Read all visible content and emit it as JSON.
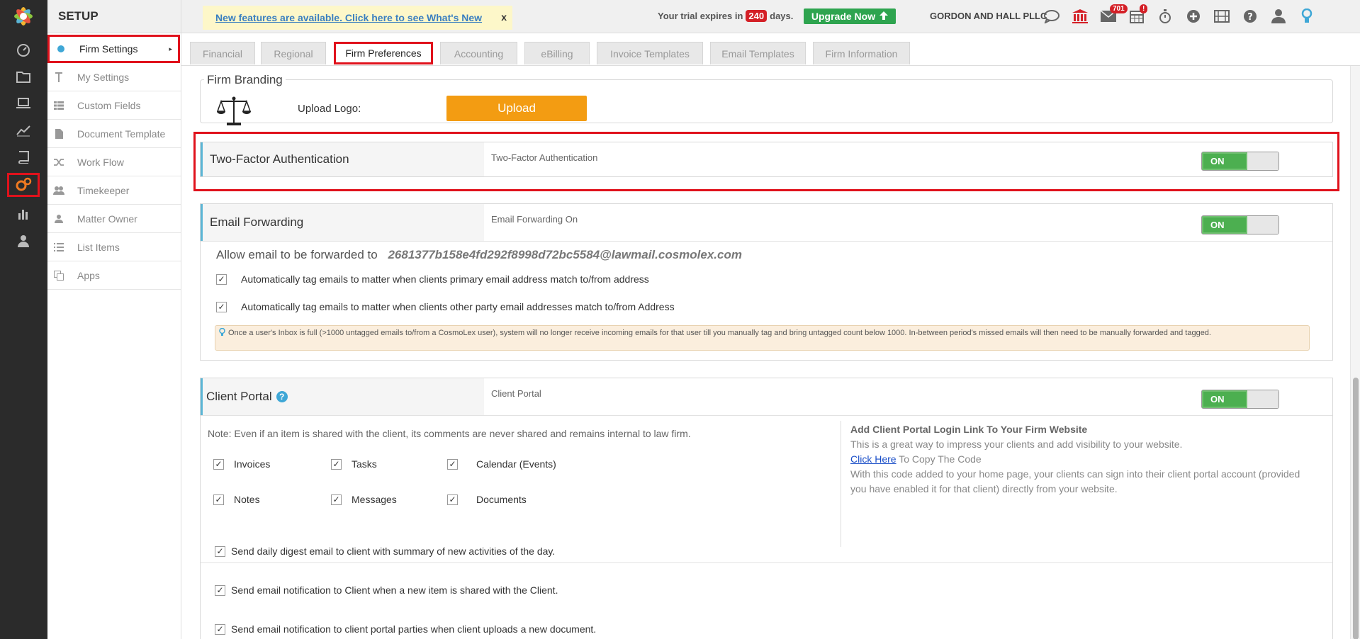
{
  "header": {
    "setup_title": "SETUP",
    "notice_text": "New features are available. Click here to see What's New",
    "notice_close": "x",
    "trial_prefix": "Your trial expires in",
    "trial_days": "240",
    "trial_suffix": "days.",
    "upgrade_label": "Upgrade Now",
    "firm_name": "GORDON AND HALL PLLC",
    "mail_badge": "701",
    "calendar_badge": "!"
  },
  "sidebar": {
    "items": [
      {
        "label": "Firm Settings"
      },
      {
        "label": "My Settings"
      },
      {
        "label": "Custom Fields"
      },
      {
        "label": "Document Template"
      },
      {
        "label": "Work Flow"
      },
      {
        "label": "Timekeeper"
      },
      {
        "label": "Matter Owner"
      },
      {
        "label": "List Items"
      },
      {
        "label": "Apps"
      }
    ]
  },
  "tabs": [
    {
      "label": "Financial"
    },
    {
      "label": "Regional"
    },
    {
      "label": "Firm Preferences"
    },
    {
      "label": "Accounting"
    },
    {
      "label": "eBilling"
    },
    {
      "label": "Invoice Templates"
    },
    {
      "label": "Email Templates"
    },
    {
      "label": "Firm Information"
    }
  ],
  "branding": {
    "legend": "Firm Branding",
    "upload_label": "Upload Logo:",
    "upload_button": "Upload"
  },
  "two_factor": {
    "title": "Two-Factor Authentication",
    "desc": "Two-Factor Authentication",
    "toggle": "ON"
  },
  "email_forwarding": {
    "title": "Email Forwarding",
    "desc": "Email Forwarding On",
    "toggle": "ON",
    "allow_text": "Allow email to be forwarded to",
    "email": "2681377b158e4fd292f8998d72bc5584@lawmail.cosmolex.com",
    "option1": "Automatically tag emails to matter when clients primary email address match to/from address",
    "option2": "Automatically tag emails to matter when clients other party email addresses match to/from Address",
    "info": "Once a user's Inbox is full (>1000 untagged emails to/from a CosmoLex user), system will no longer receive incoming emails for that user till you manually tag and bring untagged count below 1000. In-between period's missed emails will then need to be manually forwarded and tagged."
  },
  "client_portal": {
    "title": "Client Portal",
    "desc": "Client Portal",
    "toggle": "ON",
    "note": "Note: Even if an item is shared with the client, its comments are never shared and remains internal to law firm.",
    "items": [
      "Invoices",
      "Tasks",
      "Calendar (Events)",
      "Notes",
      "Messages",
      "Documents"
    ],
    "side_heading": "Add Client Portal Login Link To Your Firm Website",
    "side_line1": "This is a great way to impress your clients and add visibility to your website.",
    "side_link": "Click Here",
    "side_link_suffix": " To Copy The Code",
    "side_line3": "With this code added to your home page, your clients can sign into their client portal account (provided you have enabled it for that client) directly from your website.",
    "digest1": "Send daily digest email to client with summary of new activities of the day.",
    "digest2": "Send email notification to Client when a new item is shared with the Client.",
    "digest3": "Send email notification to client portal parties when client uploads a new document."
  },
  "colors": {
    "rail": "#2b2b2b",
    "highlight": "#e0121c",
    "toggle_on": "#4caf50",
    "upload": "#f39c12",
    "accent_blue": "#3fa7d6"
  }
}
